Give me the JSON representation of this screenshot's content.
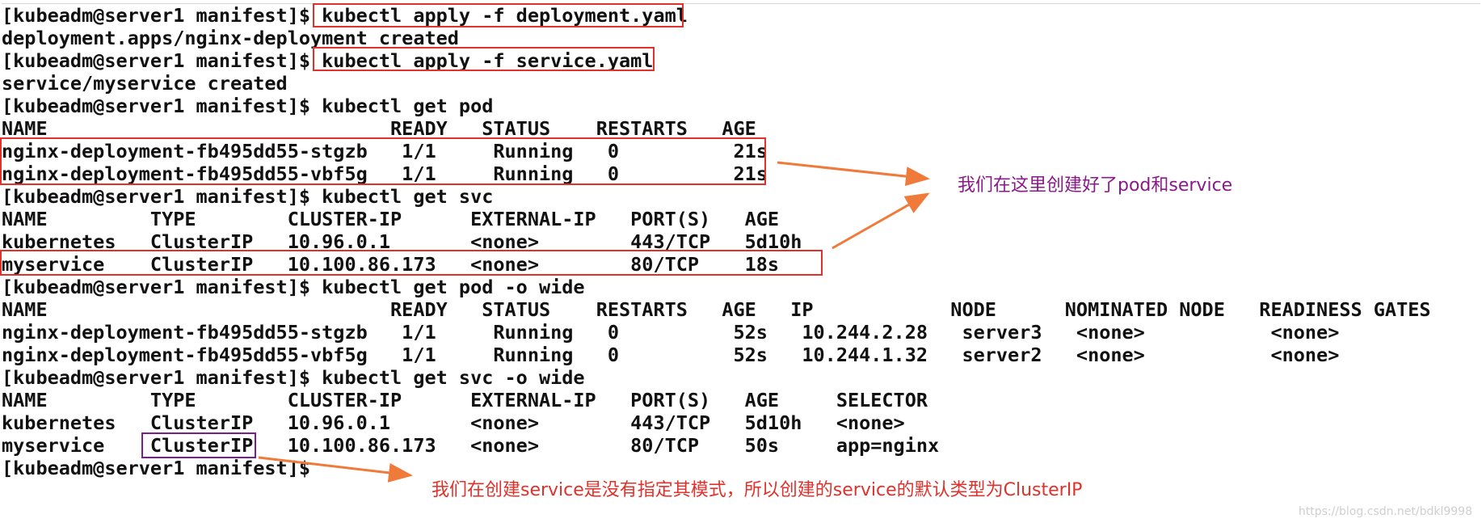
{
  "terminal": {
    "lines": [
      "[kubeadm@server1 manifest]$ kubectl apply -f deployment.yaml",
      "deployment.apps/nginx-deployment created",
      "[kubeadm@server1 manifest]$ kubectl apply -f service.yaml",
      "service/myservice created",
      "[kubeadm@server1 manifest]$ kubectl get pod",
      "NAME                              READY   STATUS    RESTARTS   AGE",
      "nginx-deployment-fb495dd55-stgzb   1/1     Running   0          21s",
      "nginx-deployment-fb495dd55-vbf5g   1/1     Running   0          21s",
      "[kubeadm@server1 manifest]$ kubectl get svc",
      "NAME         TYPE        CLUSTER-IP      EXTERNAL-IP   PORT(S)   AGE",
      "kubernetes   ClusterIP   10.96.0.1       <none>        443/TCP   5d10h",
      "myservice    ClusterIP   10.100.86.173   <none>        80/TCP    18s",
      "[kubeadm@server1 manifest]$ kubectl get pod -o wide",
      "NAME                              READY   STATUS    RESTARTS   AGE   IP            NODE      NOMINATED NODE   READINESS GATES",
      "nginx-deployment-fb495dd55-stgzb   1/1     Running   0          52s   10.244.2.28   server3   <none>           <none>",
      "nginx-deployment-fb495dd55-vbf5g   1/1     Running   0          52s   10.244.1.32   server2   <none>           <none>",
      "[kubeadm@server1 manifest]$ kubectl get svc -o wide",
      "NAME         TYPE        CLUSTER-IP      EXTERNAL-IP   PORT(S)   AGE     SELECTOR",
      "kubernetes   ClusterIP   10.96.0.1       <none>        443/TCP   5d10h   <none>",
      "myservice    ClusterIP   10.100.86.173   <none>        80/TCP    50s     app=nginx",
      "[kubeadm@server1 manifest]$"
    ]
  },
  "annotations": {
    "top_note": "我们在这里创建好了pod和service",
    "bottom_note": "我们在创建service是没有指定其模式，所以创建的service的默认类型为ClusterIP",
    "top_note_color": "#8a1a8a",
    "bottom_note_color": "#e0312b",
    "arrow_color": "#f07a3a",
    "box_color": "#e0312b",
    "purple_box_color": "#7b1f8f"
  },
  "watermark": "https://blog.csdn.net/bdkl9998"
}
